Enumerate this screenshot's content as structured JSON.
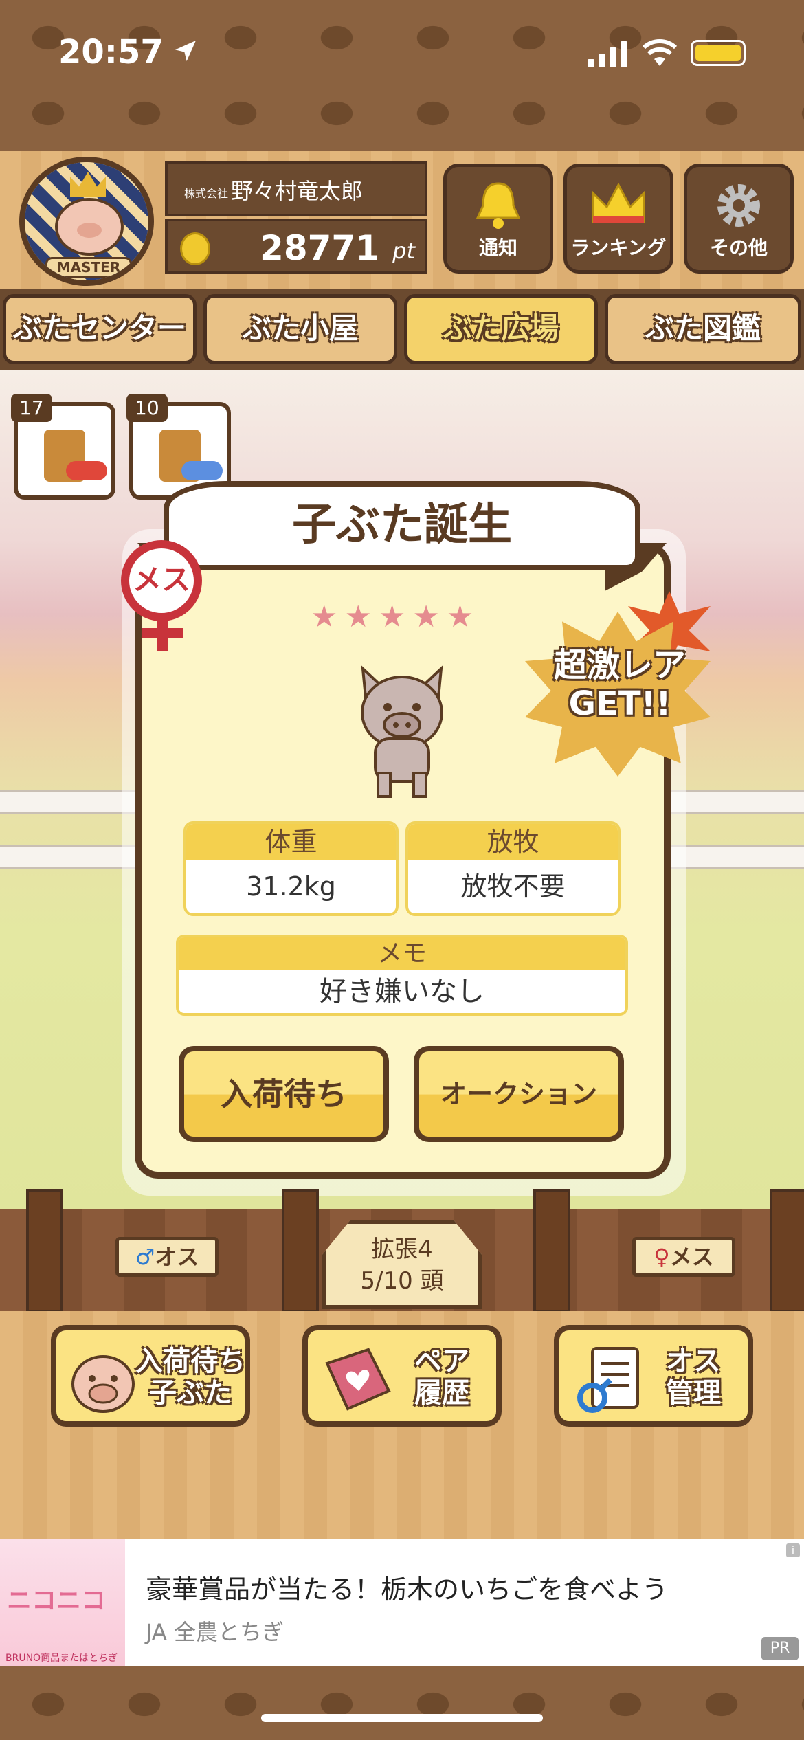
{
  "status_bar": {
    "time": "20:57"
  },
  "header": {
    "avatar_badge": "MASTER",
    "company_prefix": "株式会社",
    "player_name": "野々村竜太郎",
    "points_value": "28771",
    "points_unit": "pt",
    "buttons": [
      {
        "label": "通知",
        "icon": "bell-icon"
      },
      {
        "label": "ランキング",
        "icon": "crown-icon"
      },
      {
        "label": "その他",
        "icon": "gear-icon"
      }
    ]
  },
  "tabs": [
    {
      "label": "ぶたセンター",
      "active": false
    },
    {
      "label": "ぶた小屋",
      "active": false
    },
    {
      "label": "ぶた広場",
      "active": true
    },
    {
      "label": "ぶた図鑑",
      "active": false
    }
  ],
  "item_badges": [
    {
      "count": "17",
      "gender": "♀",
      "icon": "female-medicine-icon"
    },
    {
      "count": "10",
      "gender": "♂",
      "icon": "male-medicine-icon"
    }
  ],
  "dialog": {
    "title": "子ぶた誕生",
    "gender_badge": "メス",
    "stars": "★★★★★",
    "rarity_line1": "超激レア",
    "rarity_line2": "GET!!",
    "weight_label": "体重",
    "weight_value": "31.2kg",
    "pasture_label": "放牧",
    "pasture_value": "放牧不要",
    "memo_label": "メモ",
    "memo_value": "好き嫌いなし",
    "button_wait": "入荷待ち",
    "button_auction": "オークション"
  },
  "pen": {
    "male_sign": "♂オス",
    "female_sign": "♀メス",
    "expand_label": "拡張4",
    "capacity": "5/10 頭"
  },
  "bottom_buttons": [
    {
      "line1": "入荷待ち",
      "line2": "子ぶた",
      "icon": "piglet-icon"
    },
    {
      "line1": "ペア",
      "line2": "履歴",
      "icon": "heart-book-icon"
    },
    {
      "line1": "オス",
      "line2": "管理",
      "icon": "male-document-icon"
    }
  ],
  "ad": {
    "image_text": "ニコニコ",
    "image_subtext": "BRUNO商品またはとちぎ和牛が当たる！",
    "title": "豪華賞品が当たる！栃木のいちごを食べよう",
    "source": "JA 全農とちぎ",
    "pr": "PR",
    "info": "i"
  },
  "colors": {
    "brown": "#5a3b22",
    "yellow": "#f4d04e",
    "female_red": "#c8333b",
    "male_blue": "#2e7bd0"
  }
}
